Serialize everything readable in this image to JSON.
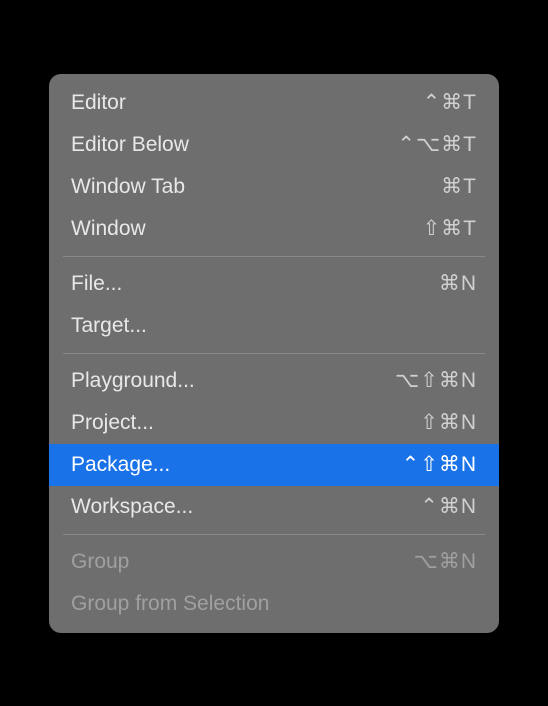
{
  "menu": {
    "items": [
      {
        "label": "Editor",
        "shortcut": "⌃⌘T",
        "enabled": true
      },
      {
        "label": "Editor Below",
        "shortcut": "⌃⌥⌘T",
        "enabled": true
      },
      {
        "label": "Window Tab",
        "shortcut": "⌘T",
        "enabled": true
      },
      {
        "label": "Window",
        "shortcut": "⇧⌘T",
        "enabled": true
      },
      {
        "separator": true
      },
      {
        "label": "File...",
        "shortcut": "⌘N",
        "enabled": true
      },
      {
        "label": "Target...",
        "shortcut": "",
        "enabled": true
      },
      {
        "separator": true
      },
      {
        "label": "Playground...",
        "shortcut": "⌥⇧⌘N",
        "enabled": true
      },
      {
        "label": "Project...",
        "shortcut": "⇧⌘N",
        "enabled": true
      },
      {
        "label": "Package...",
        "shortcut": "⌃⇧⌘N",
        "enabled": true,
        "highlighted": true
      },
      {
        "label": "Workspace...",
        "shortcut": "⌃⌘N",
        "enabled": true
      },
      {
        "separator": true
      },
      {
        "label": "Group",
        "shortcut": "⌥⌘N",
        "enabled": false
      },
      {
        "label": "Group from Selection",
        "shortcut": "",
        "enabled": false
      }
    ]
  }
}
